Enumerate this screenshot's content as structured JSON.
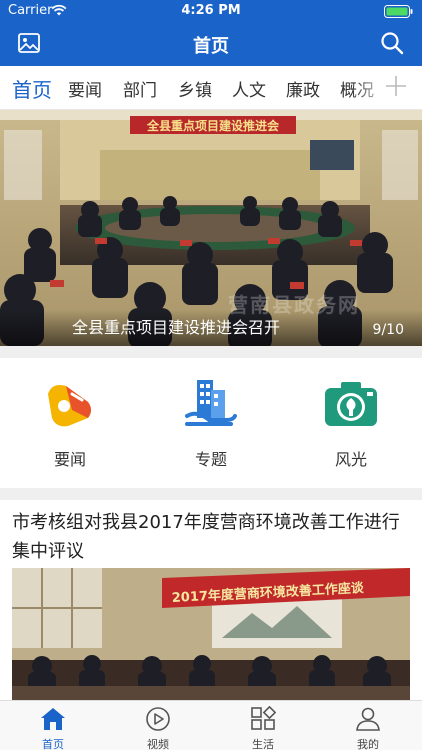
{
  "status_bar": {
    "carrier": "Carrier",
    "time": "4:26 PM"
  },
  "header": {
    "title": "首页"
  },
  "tabs": [
    {
      "label": "首页",
      "active": true
    },
    {
      "label": "要闻"
    },
    {
      "label": "部门"
    },
    {
      "label": "乡镇"
    },
    {
      "label": "人文"
    },
    {
      "label": "廉政"
    },
    {
      "label": "概况"
    }
  ],
  "banner": {
    "banner_text": "全县重点项目建设推进会",
    "caption": "全县重点项目建设推进会召开",
    "counter": "9/10",
    "watermark": "营南县政务网"
  },
  "quick_links": [
    {
      "label": "要闻",
      "icon": "news-icon"
    },
    {
      "label": "专题",
      "icon": "topic-icon"
    },
    {
      "label": "风光",
      "icon": "scenery-camera-icon"
    }
  ],
  "article": {
    "headline": "市考核组对我县2017年度营商环境改善工作进行集中评议",
    "banner_text": "2017年度营商环境改善工作座谈"
  },
  "tabbar": [
    {
      "label": "首页",
      "icon": "home-icon",
      "active": true
    },
    {
      "label": "视频",
      "icon": "play-icon"
    },
    {
      "label": "生活",
      "icon": "grid-icon"
    },
    {
      "label": "我的",
      "icon": "user-icon"
    }
  ],
  "colors": {
    "primary": "#1a63c9",
    "background": "#efefef",
    "banner_red": "#b8282a"
  }
}
